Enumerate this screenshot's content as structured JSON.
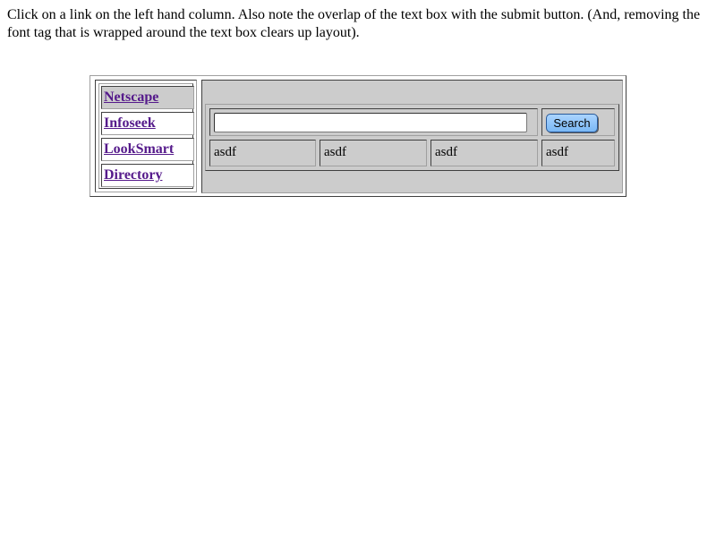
{
  "intro": {
    "text": "Click on a link on the left hand column. Also note the overlap of the text box with the submit button. (And, removing the font tag that is wrapped around the text box clears up layout)."
  },
  "sidebar": {
    "links": [
      {
        "label": "Netscape",
        "active": true
      },
      {
        "label": "Infoseek",
        "active": false
      },
      {
        "label": "LookSmart",
        "active": false
      },
      {
        "label": "Directory",
        "active": false
      }
    ]
  },
  "search": {
    "value": "",
    "placeholder": "",
    "button_label": "Search"
  },
  "results": {
    "cells": [
      "asdf",
      "asdf",
      "asdf",
      "asdf"
    ]
  },
  "colors": {
    "panel_bg": "#cccccc",
    "link": "#551a8b",
    "button": "#7ab8f5"
  }
}
